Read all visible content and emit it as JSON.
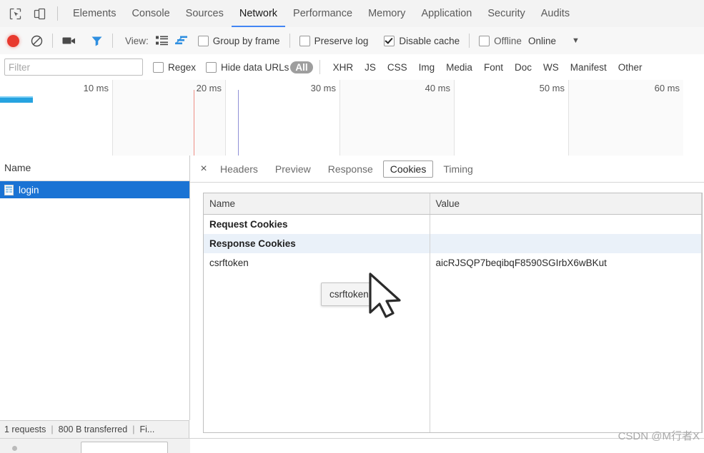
{
  "devtools": {
    "left_icons": [
      {
        "name": "inspect-element-icon",
        "label": "Inspect element"
      },
      {
        "name": "device-toolbar-icon",
        "label": "Toggle device toolbar"
      }
    ],
    "tabs": [
      {
        "label": "Elements",
        "active": false
      },
      {
        "label": "Console",
        "active": false
      },
      {
        "label": "Sources",
        "active": false
      },
      {
        "label": "Network",
        "active": true
      },
      {
        "label": "Performance",
        "active": false
      },
      {
        "label": "Memory",
        "active": false
      },
      {
        "label": "Application",
        "active": false
      },
      {
        "label": "Security",
        "active": false
      },
      {
        "label": "Audits",
        "active": false
      }
    ]
  },
  "toolbar": {
    "record_icon": "record-button",
    "clear_icon": "clear-icon",
    "camera_icon": "camera-icon",
    "filter_icon": "filter-funnel-icon",
    "view_label": "View:",
    "view_list_icon": "list-view-icon",
    "view_waterfall_icon": "waterfall-view-icon",
    "group_by_frame": {
      "label": "Group by frame",
      "checked": false
    },
    "preserve_log": {
      "label": "Preserve log",
      "checked": false
    },
    "disable_cache": {
      "label": "Disable cache",
      "checked": true
    },
    "offline": {
      "label": "Offline",
      "checked": false
    },
    "online": {
      "label": "Online"
    },
    "more_caret": "▼"
  },
  "filterbar": {
    "input_placeholder": "Filter",
    "input_value": "",
    "regex": {
      "label": "Regex",
      "checked": false
    },
    "hide_data_urls": {
      "label": "Hide data URLs",
      "checked": false
    },
    "types": [
      {
        "label": "All",
        "selected": true
      },
      {
        "label": "XHR",
        "selected": false
      },
      {
        "label": "JS",
        "selected": false
      },
      {
        "label": "CSS",
        "selected": false
      },
      {
        "label": "Img",
        "selected": false
      },
      {
        "label": "Media",
        "selected": false
      },
      {
        "label": "Font",
        "selected": false
      },
      {
        "label": "Doc",
        "selected": false
      },
      {
        "label": "WS",
        "selected": false
      },
      {
        "label": "Manifest",
        "selected": false
      },
      {
        "label": "Other",
        "selected": false
      }
    ]
  },
  "overview": {
    "ticks": [
      "10 ms",
      "20 ms",
      "30 ms",
      "40 ms",
      "50 ms",
      "60 ms"
    ],
    "dom_content_loaded_color": "#ef8f86",
    "load_event_color": "#8f90d6",
    "request_bar_color": "#26a3e0"
  },
  "requests": {
    "column_header": "Name",
    "rows": [
      {
        "name": "login",
        "icon": "document-icon",
        "selected": true
      }
    ]
  },
  "statusbar": {
    "requests": "1 requests",
    "transferred": "800 B transferred",
    "finish": "Fi...",
    "separator": "|"
  },
  "detail": {
    "close_label": "×",
    "tabs": [
      {
        "label": "Headers",
        "active": false
      },
      {
        "label": "Preview",
        "active": false
      },
      {
        "label": "Response",
        "active": false
      },
      {
        "label": "Cookies",
        "active": true
      },
      {
        "label": "Timing",
        "active": false
      }
    ],
    "cookies_table": {
      "columns": [
        "Name",
        "Value"
      ],
      "rows": [
        {
          "type": "group",
          "name": "Request Cookies",
          "value": ""
        },
        {
          "type": "group",
          "name": "Response Cookies",
          "value": ""
        },
        {
          "type": "cookie",
          "name": "csrftoken",
          "value": "aicRJSQP7beqibqF8590SGIrbX6wBKut"
        }
      ]
    }
  },
  "tooltip": {
    "text": "csrftoken"
  },
  "watermark": {
    "text": "CSDN @M行者X"
  }
}
